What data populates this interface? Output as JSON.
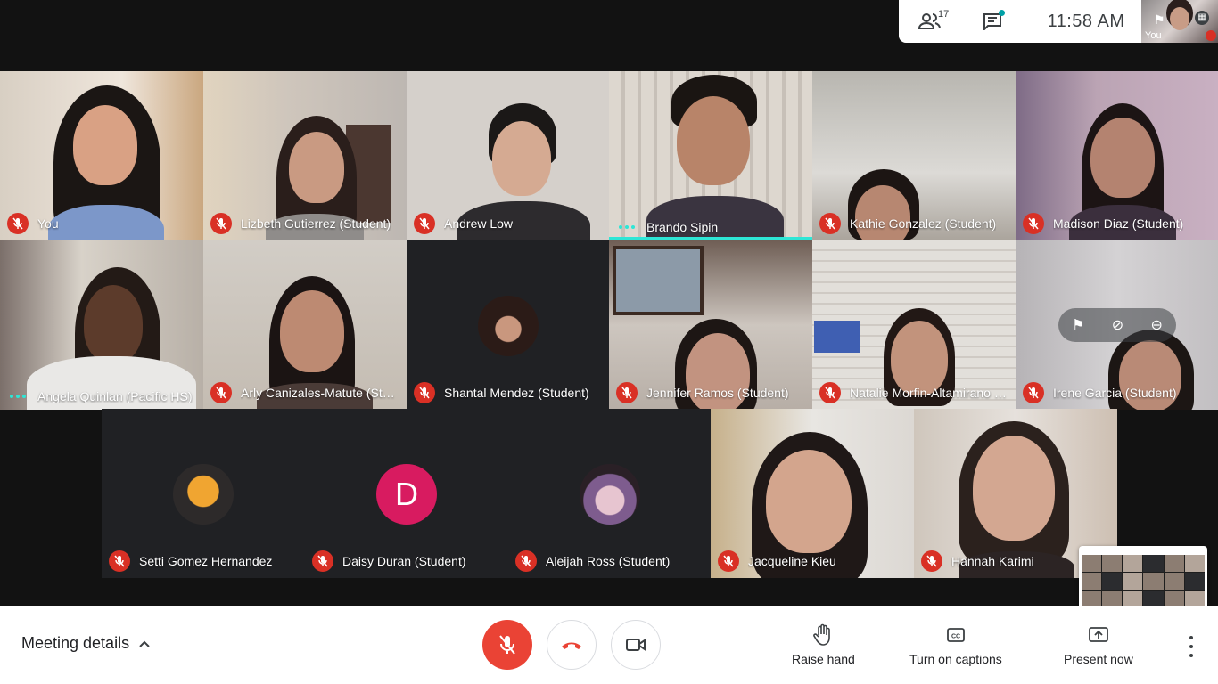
{
  "topbar": {
    "participant_count": "17",
    "time": "11:58 AM",
    "self_label": "You"
  },
  "participants": [
    {
      "name": "You",
      "status": "muted"
    },
    {
      "name": "Lizbeth Gutierrez (Student)",
      "status": "muted"
    },
    {
      "name": "Andrew Low",
      "status": "muted"
    },
    {
      "name": "Brando Sipin",
      "status": "speaking"
    },
    {
      "name": "Kathie Gonzalez (Student)",
      "status": "muted"
    },
    {
      "name": "Madison Diaz (Student)",
      "status": "muted"
    },
    {
      "name": "Angela Quinlan (Pacific HS)",
      "status": "speaking"
    },
    {
      "name": "Arly Canizales-Matute (Student)",
      "status": "muted"
    },
    {
      "name": "Shantal Mendez (Student)",
      "status": "muted"
    },
    {
      "name": "Jennifer Ramos (Student)",
      "status": "muted"
    },
    {
      "name": "Natalie Morfin-Altamirano (Student)",
      "status": "muted"
    },
    {
      "name": "Irene Garcia (Student)",
      "status": "muted"
    },
    {
      "name": "Setti Gomez Hernandez",
      "status": "muted"
    },
    {
      "name": "Daisy Duran (Student)",
      "status": "muted",
      "avatar_letter": "D"
    },
    {
      "name": "Aleijah Ross (Student)",
      "status": "muted"
    },
    {
      "name": "Jacqueline Kieu",
      "status": "muted"
    },
    {
      "name": "Hannah Karimi",
      "status": "muted"
    }
  ],
  "controls": {
    "meeting_details": "Meeting details",
    "raise_hand": "Raise hand",
    "captions": "Turn on captions",
    "present": "Present now"
  },
  "colors": {
    "mute_red": "#d93025",
    "mic_button": "#ea4335",
    "speaking_teal": "#2ee6d6",
    "avatar_pink": "#d81b60"
  },
  "icons": [
    "people-icon",
    "chat-icon",
    "pin-icon",
    "mic-off-icon",
    "call-end-icon",
    "videocam-icon",
    "hand-icon",
    "captions-icon",
    "present-icon",
    "more-vert-icon",
    "chevron-up-icon"
  ]
}
